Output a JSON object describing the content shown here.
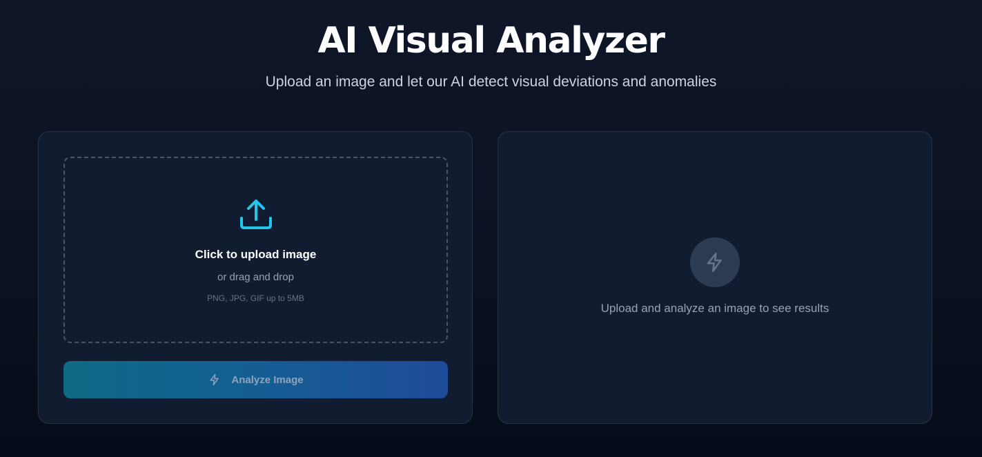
{
  "header": {
    "title": "AI Visual Analyzer",
    "subtitle": "Upload an image and let our AI detect visual deviations and anomalies"
  },
  "upload": {
    "icon": "upload-icon",
    "title": "Click to upload image",
    "subtitle": "or drag and drop",
    "hint": "PNG, JPG, GIF up to 5MB"
  },
  "analyze_button": {
    "icon": "lightning-icon",
    "label": "Analyze Image"
  },
  "results": {
    "icon": "lightning-icon",
    "placeholder": "Upload and analyze an image to see results"
  },
  "colors": {
    "accent": "#22c7ee",
    "background": "#0b1222",
    "panel": "#121c30",
    "button_gradient_start": "#0e6a86",
    "button_gradient_end": "#1e4b98"
  }
}
